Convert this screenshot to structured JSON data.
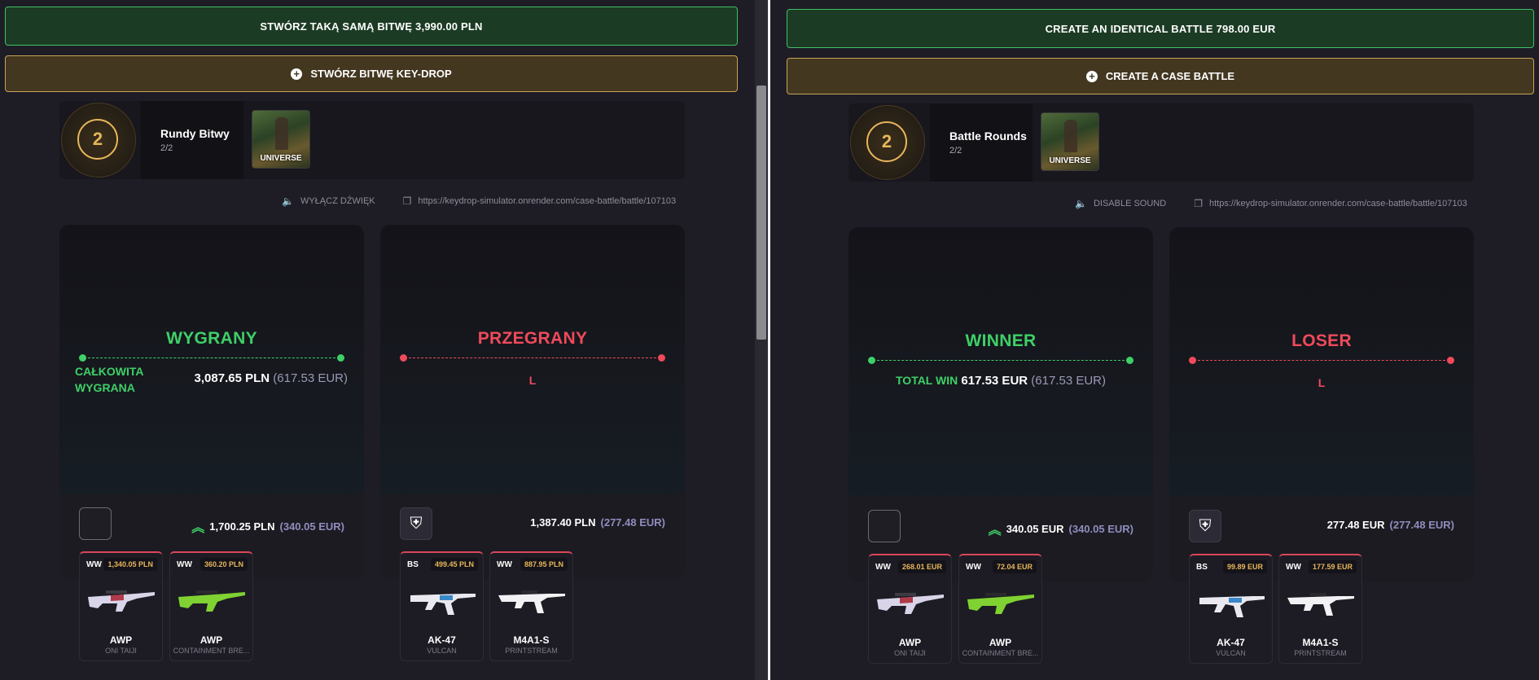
{
  "left": {
    "create_same_label": "STWÓRZ TAKĄ SAMĄ BITWĘ 3,990.00 PLN",
    "create_battle_label": "STWÓRZ BITWĘ KEY-DROP",
    "rounds": {
      "count": "2",
      "title": "Rundy Bitwy",
      "progress": "2/2",
      "case_name": "UNIVERSE"
    },
    "sound_label": "WYŁĄCZ DŹWIĘK",
    "url": "https://keydrop-simulator.onrender.com/case-battle/battle/107103",
    "players": [
      {
        "status": "WYGRANY",
        "total_label": "CAŁKOWITA WYGRANA",
        "total_main": "3,087.65 PLN",
        "total_eur": "(617.53 EUR)",
        "sum_main": "1,700.25 PLN",
        "sum_eur": "(340.05 EUR)",
        "items": [
          {
            "cond": "WW",
            "price": "1,340.05 PLN",
            "gun": "AWP",
            "skin": "ONI TAIJI"
          },
          {
            "cond": "WW",
            "price": "360.20 PLN",
            "gun": "AWP",
            "skin": "CONTAINMENT BRE..."
          }
        ]
      },
      {
        "status": "PRZEGRANY",
        "loser_text": "L",
        "sum_main": "1,387.40 PLN",
        "sum_eur": "(277.48 EUR)",
        "items": [
          {
            "cond": "BS",
            "price": "499.45 PLN",
            "gun": "AK-47",
            "skin": "VULCAN"
          },
          {
            "cond": "WW",
            "price": "887.95 PLN",
            "gun": "M4A1-S",
            "skin": "PRINTSTREAM"
          }
        ]
      }
    ]
  },
  "right": {
    "create_same_label": "CREATE AN IDENTICAL BATTLE 798.00 EUR",
    "create_battle_label": "CREATE A CASE BATTLE",
    "rounds": {
      "count": "2",
      "title": "Battle Rounds",
      "progress": "2/2",
      "case_name": "UNIVERSE"
    },
    "sound_label": "DISABLE SOUND",
    "url": "https://keydrop-simulator.onrender.com/case-battle/battle/107103",
    "players": [
      {
        "status": "WINNER",
        "total_label": "TOTAL WIN",
        "total_main": "617.53 EUR",
        "total_eur": "(617.53 EUR)",
        "sum_main": "340.05 EUR",
        "sum_eur": "(340.05 EUR)",
        "items": [
          {
            "cond": "WW",
            "price": "268.01 EUR",
            "gun": "AWP",
            "skin": "ONI TAIJI"
          },
          {
            "cond": "WW",
            "price": "72.04 EUR",
            "gun": "AWP",
            "skin": "CONTAINMENT BRE..."
          }
        ]
      },
      {
        "status": "LOSER",
        "loser_text": "L",
        "sum_main": "277.48 EUR",
        "sum_eur": "(277.48 EUR)",
        "items": [
          {
            "cond": "BS",
            "price": "99.89 EUR",
            "gun": "AK-47",
            "skin": "VULCAN"
          },
          {
            "cond": "WW",
            "price": "177.59 EUR",
            "gun": "M4A1-S",
            "skin": "PRINTSTREAM"
          }
        ]
      }
    ]
  },
  "colors": {
    "win": "#3fd067",
    "lose": "#f04a5b",
    "gold": "#e8b65a",
    "eur": "#8f8dbd"
  },
  "icons": {
    "plus": "plus-circle-icon",
    "sound": "speaker-icon",
    "copy": "copy-icon",
    "up": "double-chevron-up-icon"
  }
}
